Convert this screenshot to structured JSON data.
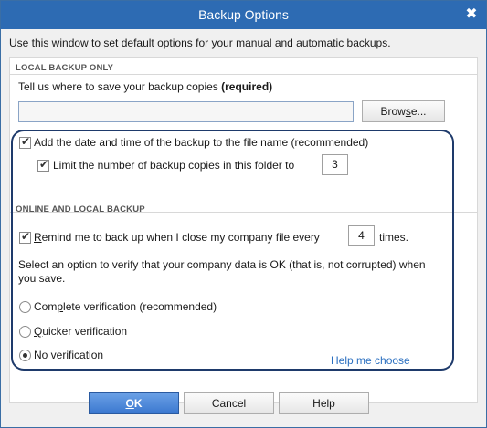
{
  "window": {
    "title": "Backup Options",
    "close_glyph": "✖"
  },
  "intro": "Use this window to set default options for your manual and automatic backups.",
  "local_backup": {
    "section_label": "LOCAL BACKUP ONLY",
    "prompt": "Tell us where to save your backup copies",
    "prompt_required": "(required)",
    "path_value": "",
    "browse_pre": "Brow",
    "browse_ul": "s",
    "browse_post": "e..."
  },
  "date_time_option": {
    "label": "Add the date and time of the backup to the file name (recommended)",
    "checked": true
  },
  "limit_option": {
    "label": "Limit the number of backup copies in this folder to",
    "checked": true,
    "value": "3"
  },
  "online_local": {
    "section_label": "ONLINE AND LOCAL BACKUP",
    "remind_ul": "R",
    "remind_rest": "emind me to back up when I close my company file every",
    "remind_checked": true,
    "remind_value": "4",
    "remind_suffix": "times.",
    "verify_prompt_line1": "Select an option to verify that your company data is OK (that is, not corrupted) when",
    "verify_prompt_line2": "you save.",
    "options": [
      {
        "pre": "Com",
        "ul": "p",
        "post": "lete verification (recommended)",
        "selected": false
      },
      {
        "pre": "",
        "ul": "Q",
        "post": "uicker verification",
        "selected": false
      },
      {
        "pre": "",
        "ul": "N",
        "post": "o verification",
        "selected": true
      }
    ],
    "help_link": "Help me choose"
  },
  "buttons": {
    "ok_ul": "O",
    "ok_rest": "K",
    "cancel": "Cancel",
    "help": "Help"
  },
  "colors": {
    "accent": "#2d6bb3",
    "highlight_ring": "#1e3a6b",
    "link": "#2a6fc0"
  }
}
